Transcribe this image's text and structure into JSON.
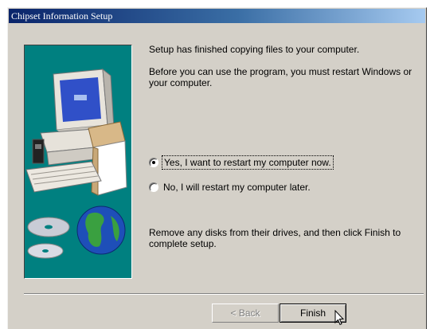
{
  "window": {
    "title": "Chipset Information Setup"
  },
  "message": {
    "line1": "Setup has finished copying files to your computer.",
    "line2": "Before you can use the program, you must restart Windows or your computer.",
    "line3": "Remove any disks from their drives, and then click Finish to complete setup."
  },
  "options": {
    "restart_now": {
      "label": "Yes, I want to restart my computer now.",
      "selected": true
    },
    "restart_later": {
      "label": "No, I will restart my computer later.",
      "selected": false
    }
  },
  "buttons": {
    "back_label": "< Back",
    "finish_label": "Finish"
  },
  "colors": {
    "title_start": "#0a246a",
    "art_bg": "#008080",
    "face": "#d4d0c8"
  },
  "icons": {
    "cursor": "arrow-cursor-icon",
    "illustration": "computer-cd-globe-illustration"
  }
}
